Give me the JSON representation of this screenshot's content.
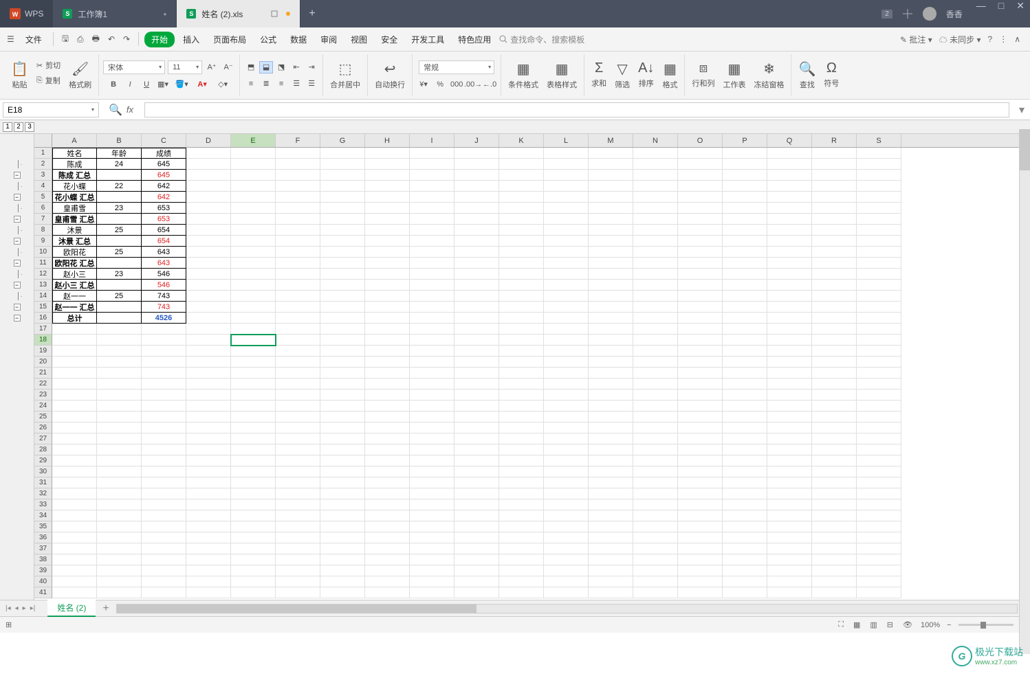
{
  "app": {
    "name": "WPS"
  },
  "tabs": [
    {
      "icon": "S",
      "label": "工作簿1",
      "active": false,
      "dirty": true
    },
    {
      "icon": "S",
      "label": "姓名 (2).xls",
      "active": true,
      "dirty": true
    }
  ],
  "user": {
    "name": "香香",
    "badge": "2"
  },
  "menu": {
    "file": "文件",
    "items": [
      "开始",
      "插入",
      "页面布局",
      "公式",
      "数据",
      "审阅",
      "视图",
      "安全",
      "开发工具",
      "特色应用"
    ],
    "search_placeholder": "查找命令、搜索模板",
    "annotate": "批注",
    "sync": "未同步"
  },
  "ribbon": {
    "paste": "粘贴",
    "cut": "剪切",
    "copy": "复制",
    "format_painter": "格式刷",
    "font_name": "宋体",
    "font_size": "11",
    "merge_center": "合并居中",
    "wrap": "自动换行",
    "number_format": "常规",
    "cond_format": "条件格式",
    "table_style": "表格样式",
    "sum": "求和",
    "filter": "筛选",
    "sort": "排序",
    "format": "格式",
    "row_col": "行和列",
    "worksheet": "工作表",
    "freeze": "冻结窗格",
    "find": "查找",
    "symbol": "符号"
  },
  "namebox": "E18",
  "columns": [
    "A",
    "B",
    "C",
    "D",
    "E",
    "F",
    "G",
    "H",
    "I",
    "J",
    "K",
    "L",
    "M",
    "N",
    "O",
    "P",
    "Q",
    "R",
    "S"
  ],
  "table": {
    "headers": [
      "姓名",
      "年龄",
      "成绩"
    ],
    "rows": [
      {
        "a": "陈成",
        "b": "24",
        "c": "645",
        "type": "data"
      },
      {
        "a": "陈成 汇总",
        "b": "",
        "c": "645",
        "type": "subtotal"
      },
      {
        "a": "花小蝶",
        "b": "22",
        "c": "642",
        "type": "data"
      },
      {
        "a": "花小蝶 汇总",
        "b": "",
        "c": "642",
        "type": "subtotal"
      },
      {
        "a": "皇甫雪",
        "b": "23",
        "c": "653",
        "type": "data"
      },
      {
        "a": "皇甫雪 汇总",
        "b": "",
        "c": "653",
        "type": "subtotal"
      },
      {
        "a": "沐景",
        "b": "25",
        "c": "654",
        "type": "data"
      },
      {
        "a": "沐景 汇总",
        "b": "",
        "c": "654",
        "type": "subtotal"
      },
      {
        "a": "欧阳花",
        "b": "25",
        "c": "643",
        "type": "data"
      },
      {
        "a": "欧阳花 汇总",
        "b": "",
        "c": "643",
        "type": "subtotal"
      },
      {
        "a": "赵小三",
        "b": "23",
        "c": "546",
        "type": "data"
      },
      {
        "a": "赵小三 汇总",
        "b": "",
        "c": "546",
        "type": "subtotal"
      },
      {
        "a": "赵一一",
        "b": "25",
        "c": "743",
        "type": "data"
      },
      {
        "a": "赵一一 汇总",
        "b": "",
        "c": "743",
        "type": "subtotal"
      },
      {
        "a": "总计",
        "b": "",
        "c": "4526",
        "type": "grand"
      }
    ]
  },
  "active_cell": {
    "row": 18,
    "col": "E"
  },
  "total_display_rows": 41,
  "sheet": {
    "name": "姓名 (2)"
  },
  "status": {
    "zoom": "100%"
  },
  "watermark": {
    "title": "极光下载站",
    "url": "www.xz7.com"
  }
}
